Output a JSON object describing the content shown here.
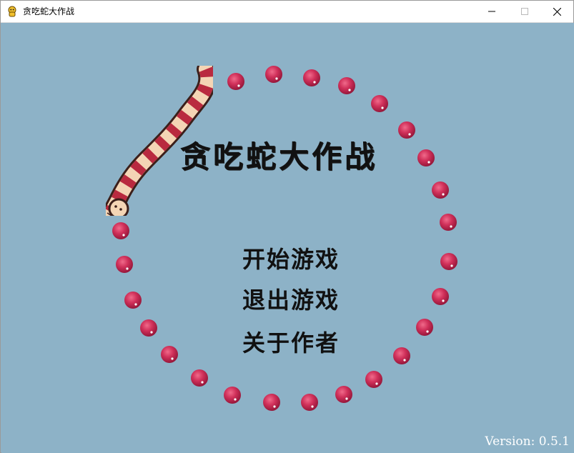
{
  "window": {
    "title": "贪吃蛇大作战",
    "icon": "python-icon",
    "controls": {
      "minimize": "minimize-icon",
      "maximize": "maximize-icon",
      "close": "close-icon"
    }
  },
  "game": {
    "title": "贪吃蛇大作战",
    "menu": {
      "start": "开始游戏",
      "quit": "退出游戏",
      "about": "关于作者"
    },
    "version": "Version: 0.5.1"
  },
  "colors": {
    "background": "#8db2c7",
    "dot": "#c8264d",
    "text": "#111111"
  }
}
